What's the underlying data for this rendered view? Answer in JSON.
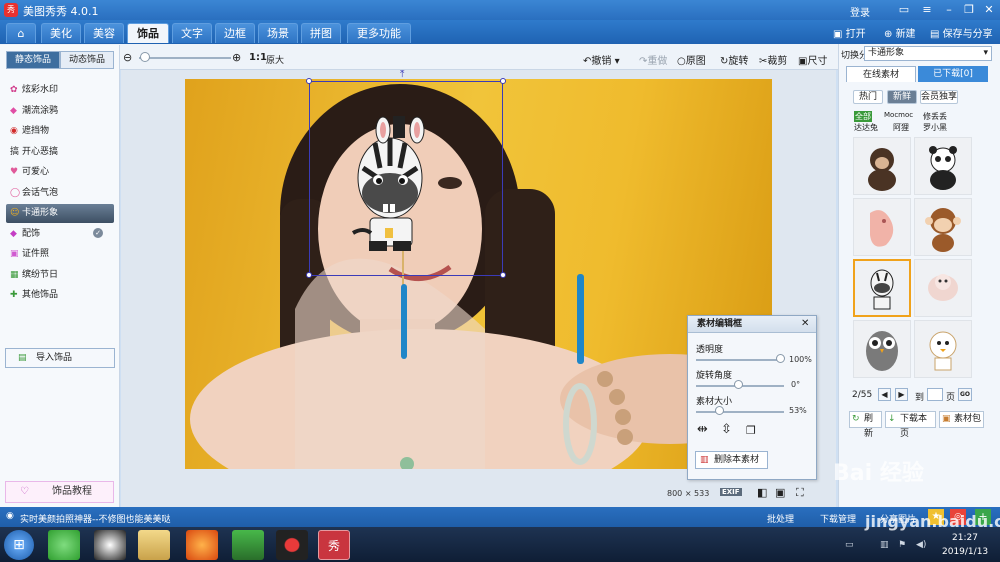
{
  "app": {
    "title": "美图秀秀 4.0.1",
    "icon_text": "秀",
    "login": "登录"
  },
  "nav": {
    "tabs": [
      "美化",
      "美容",
      "饰品",
      "文字",
      "边框",
      "场景",
      "拼图",
      "更多功能"
    ],
    "active": "饰品",
    "open_label": "打开",
    "new_label": "新建",
    "save_label": "保存与分享"
  },
  "toolbar": {
    "zoom_one": "1:1",
    "zoom_orig": "原大",
    "undo": "撤销",
    "redo": "重做",
    "original": "原图",
    "rotate": "旋转",
    "crop": "裁剪",
    "size": "尺寸"
  },
  "left": {
    "tabs": [
      "静态饰品",
      "动态饰品"
    ],
    "items": [
      {
        "label": "炫彩水印",
        "icon": "✿",
        "color": "#d03a8a"
      },
      {
        "label": "潮流涂鸦",
        "icon": "◆",
        "color": "#e04ea5"
      },
      {
        "label": "遮挡物",
        "icon": "◉",
        "color": "#d12b2b"
      },
      {
        "label": "开心恶搞",
        "icon": "搞",
        "color": "#333333"
      },
      {
        "label": "可爱心",
        "icon": "♥",
        "color": "#e05a9a"
      },
      {
        "label": "会话气泡",
        "icon": "◯",
        "color": "#e05a9a"
      },
      {
        "label": "卡通形象",
        "icon": "☺",
        "color": "#f0b020"
      },
      {
        "label": "配饰",
        "icon": "◆",
        "color": "#c43ec4"
      },
      {
        "label": "证件照",
        "icon": "▣",
        "color": "#d05ad0"
      },
      {
        "label": "缤纷节日",
        "icon": "▦",
        "color": "#3a9a3a"
      },
      {
        "label": "其他饰品",
        "icon": "✚",
        "color": "#3a9a3a"
      }
    ],
    "active_index": 6,
    "import_label": "导入饰品",
    "tutorial_label": "饰品教程"
  },
  "editor": {
    "title": "素材编辑框",
    "sliders": [
      {
        "label": "透明度",
        "value_text": "100%",
        "value": 1.0
      },
      {
        "label": "旋转角度",
        "value_text": "0°",
        "value": 0.5
      },
      {
        "label": "素材大小",
        "value_text": "53%",
        "value": 0.27
      }
    ],
    "delete_label": "删除本素材"
  },
  "status": {
    "dims": "800 × 533",
    "exif": "EXIF"
  },
  "right": {
    "category_label": "切换分类",
    "category_value": "卡通形象",
    "tabs": [
      "在线素材",
      "已下载[0]"
    ],
    "chips": [
      "热门",
      "新鲜",
      "会员独享"
    ],
    "active_chip": "新鲜",
    "tags_row1": [
      "全部",
      "Mocmoc",
      "修丢丢"
    ],
    "tags_row2": [
      "达达兔",
      "阿狸",
      "罗小黑"
    ],
    "thumbs": [
      "chimpanzee",
      "panda",
      "pink-creature",
      "monkey",
      "zebra",
      "sheep",
      "owl",
      "bird"
    ],
    "selected_thumb": 4,
    "page_text": "2/55",
    "goto_label": "到",
    "page_unit": "页",
    "go_label": "GO",
    "refresh_label": "刷新",
    "download_page_label": "下载本页",
    "bag_label": "素材包"
  },
  "bottom": {
    "tip": "实时美颜拍照神器--不修图也能美美哒",
    "batch": "批处理",
    "download_mgr": "下载管理",
    "share": "分享图片"
  },
  "taskbar": {
    "time": "21:27",
    "date": "2019/1/13"
  },
  "watermark": "jingyan.baidu.com"
}
